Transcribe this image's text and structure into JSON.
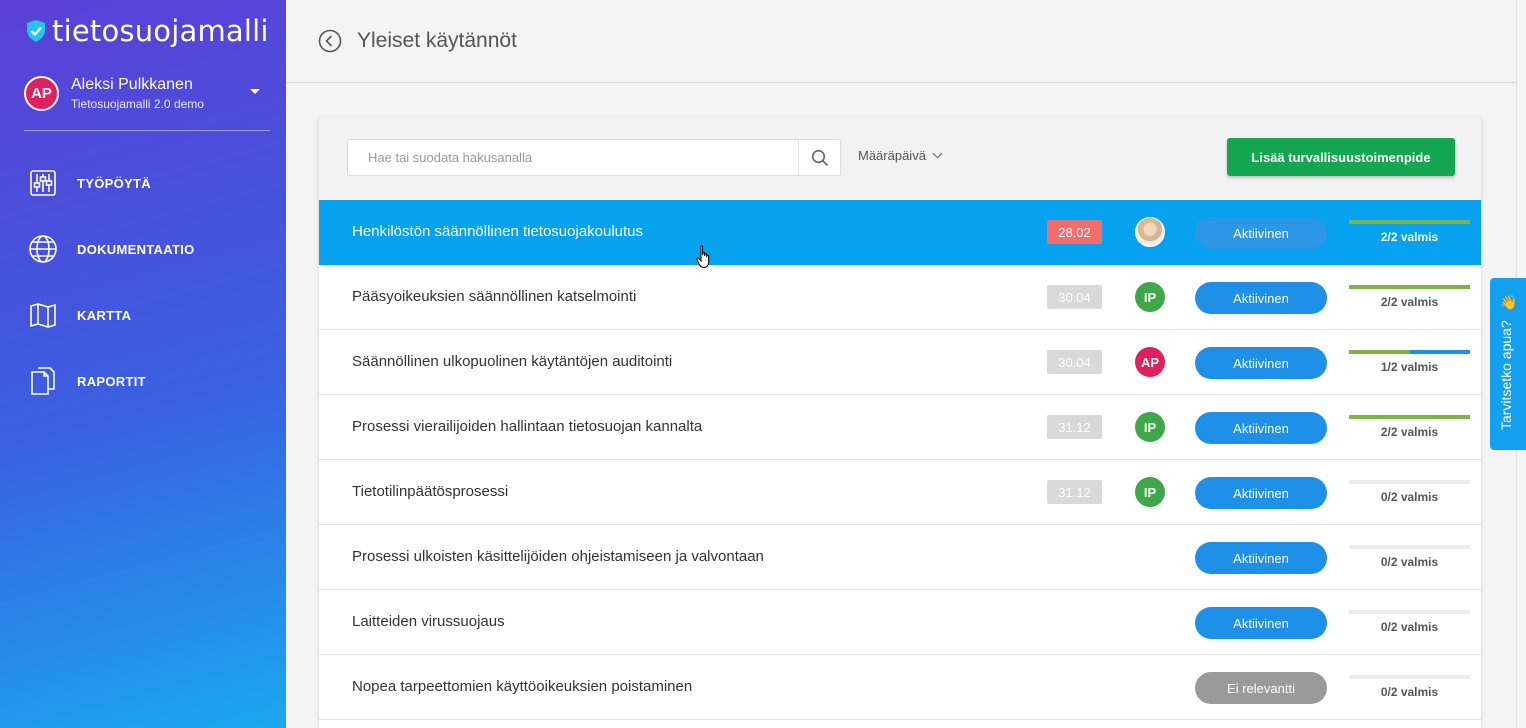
{
  "sidebar": {
    "logo_text": "tietosuojamalli",
    "user": {
      "initials": "AP",
      "name": "Aleksi Pulkkanen",
      "org": "Tietosuojamalli 2.0 demo"
    },
    "nav": [
      {
        "label": "TYÖPÖYTÄ",
        "icon": "sliders-icon"
      },
      {
        "label": "DOKUMENTAATIO",
        "icon": "globe-icon"
      },
      {
        "label": "KARTTA",
        "icon": "map-icon"
      },
      {
        "label": "RAPORTIT",
        "icon": "documents-icon"
      }
    ]
  },
  "header": {
    "title": "Yleiset käytännöt"
  },
  "toolbar": {
    "search_placeholder": "Hae tai suodata hakusanalla",
    "sort_label": "Määräpäivä",
    "add_label": "Lisää turvallisuustoimenpide"
  },
  "rows": [
    {
      "title": "Henkilöstön säännöllinen tietosuojakoulutus",
      "date": "28.02",
      "overdue": true,
      "assignee": "photo",
      "status": "Aktiivinen",
      "done": 2,
      "total": 2,
      "progress_label": "2/2 valmis",
      "selected": true
    },
    {
      "title": "Pääsyoikeuksien säännöllinen katselmointi",
      "date": "30.04",
      "assignee": "IP",
      "status": "Aktiivinen",
      "done": 2,
      "total": 2,
      "progress_label": "2/2 valmis"
    },
    {
      "title": "Säännöllinen ulkopuolinen käytäntöjen auditointi",
      "date": "30.04",
      "assignee": "AP",
      "status": "Aktiivinen",
      "done": 1,
      "total": 2,
      "progress_label": "1/2 valmis"
    },
    {
      "title": "Prosessi vierailijoiden hallintaan tietosuojan kannalta",
      "date": "31.12",
      "assignee": "IP",
      "status": "Aktiivinen",
      "done": 2,
      "total": 2,
      "progress_label": "2/2 valmis"
    },
    {
      "title": "Tietotilinpäätösprosessi",
      "date": "31.12",
      "assignee": "IP",
      "status": "Aktiivinen",
      "done": 0,
      "total": 2,
      "progress_label": "0/2 valmis"
    },
    {
      "title": "Prosessi ulkoisten käsittelijöiden ohjeistamiseen ja valvontaan",
      "date": "",
      "assignee": "",
      "status": "Aktiivinen",
      "done": 0,
      "total": 2,
      "progress_label": "0/2 valmis"
    },
    {
      "title": "Laitteiden virussuojaus",
      "date": "",
      "assignee": "",
      "status": "Aktiivinen",
      "done": 0,
      "total": 2,
      "progress_label": "0/2 valmis"
    },
    {
      "title": "Nopea tarpeettomien käyttöoikeuksien poistaminen",
      "date": "",
      "assignee": "",
      "status": "Ei relevantti",
      "status_style": "gray",
      "done": 0,
      "total": 2,
      "progress_label": "0/2 valmis"
    }
  ],
  "help": {
    "label": "Tarvitsetko apua?",
    "emoji": "👋"
  },
  "colors": {
    "accent": "#07a2ef",
    "primary_green": "#14a650",
    "overdue": "#f26d6d",
    "progress_green": "#7cb342"
  }
}
